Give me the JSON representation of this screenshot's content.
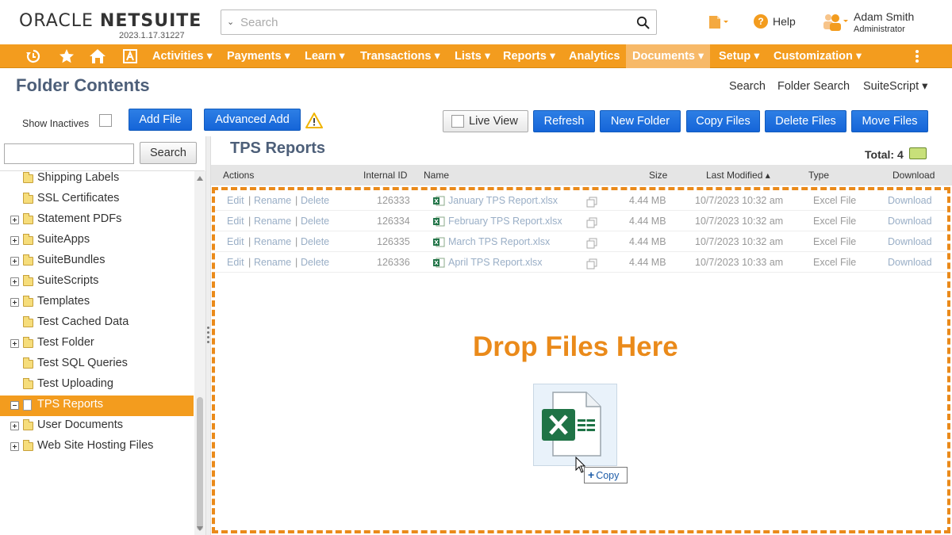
{
  "header": {
    "logo_a": "ORACLE",
    "logo_b": "NETSUITE",
    "version": "2023.1.17.31227",
    "search_placeholder": "Search",
    "help_label": "Help",
    "user_name": "Adam Smith",
    "user_role": "Administrator"
  },
  "nav": {
    "items": [
      "Activities ▾",
      "Payments ▾",
      "Learn ▾",
      "Transactions ▾",
      "Lists ▾",
      "Reports ▾",
      "Analytics",
      "Documents ▾",
      "Setup ▾",
      "Customization ▾"
    ],
    "active": "Documents ▾",
    "icons": [
      "recent-icon",
      "star-icon",
      "home-icon",
      "ai-icon",
      "more-vertical-icon"
    ]
  },
  "page": {
    "title": "Folder Contents",
    "links": [
      "Search",
      "Folder Search",
      "SuiteScript ▾"
    ]
  },
  "toolbar": {
    "show_inactives": "Show Inactives",
    "add_file": "Add File",
    "advanced_add": "Advanced Add",
    "live_view": "Live View",
    "refresh": "Refresh",
    "new_folder": "New Folder",
    "copy_files": "Copy Files",
    "delete_files": "Delete Files",
    "move_files": "Move Files"
  },
  "sidebar": {
    "search_button": "Search",
    "items": [
      {
        "label": "Shipping Labels",
        "expandable": false
      },
      {
        "label": "SSL Certificates",
        "expandable": false
      },
      {
        "label": "Statement PDFs",
        "expandable": true
      },
      {
        "label": "SuiteApps",
        "expandable": true
      },
      {
        "label": "SuiteBundles",
        "expandable": true
      },
      {
        "label": "SuiteScripts",
        "expandable": true
      },
      {
        "label": "Templates",
        "expandable": true
      },
      {
        "label": "Test Cached Data",
        "expandable": false
      },
      {
        "label": "Test Folder",
        "expandable": true
      },
      {
        "label": "Test SQL Queries",
        "expandable": false
      },
      {
        "label": "Test Uploading",
        "expandable": false
      },
      {
        "label": "TPS Reports",
        "expandable": true,
        "selected": true
      },
      {
        "label": "User Documents",
        "expandable": true
      },
      {
        "label": "Web Site Hosting Files",
        "expandable": true
      }
    ]
  },
  "main": {
    "folder_title": "TPS Reports",
    "total_label": "Total: 4",
    "columns": [
      "Actions",
      "Internal ID",
      "Name",
      "Size",
      "Last Modified ▴",
      "Type",
      "Download"
    ],
    "rows": [
      {
        "edit": "Edit",
        "rename": "Rename",
        "delete": "Delete",
        "id": "126333",
        "name": "January TPS Report.xlsx",
        "size": "4.44 MB",
        "modified": "10/7/2023 10:32 am",
        "type": "Excel File",
        "download": "Download"
      },
      {
        "edit": "Edit",
        "rename": "Rename",
        "delete": "Delete",
        "id": "126334",
        "name": "February TPS Report.xlsx",
        "size": "4.44 MB",
        "modified": "10/7/2023 10:32 am",
        "type": "Excel File",
        "download": "Download"
      },
      {
        "edit": "Edit",
        "rename": "Rename",
        "delete": "Delete",
        "id": "126335",
        "name": "March TPS Report.xlsx",
        "size": "4.44 MB",
        "modified": "10/7/2023 10:32 am",
        "type": "Excel File",
        "download": "Download"
      },
      {
        "edit": "Edit",
        "rename": "Rename",
        "delete": "Delete",
        "id": "126336",
        "name": "April TPS Report.xlsx",
        "size": "4.44 MB",
        "modified": "10/7/2023 10:33 am",
        "type": "Excel File",
        "download": "Download"
      }
    ],
    "drop_text": "Drop Files Here",
    "drag_tooltip": "Copy"
  },
  "colors": {
    "accent": "#f39c1e",
    "button_blue": "#1a73e8",
    "title_slate": "#4d5f79",
    "excel_green": "#1f7346"
  }
}
